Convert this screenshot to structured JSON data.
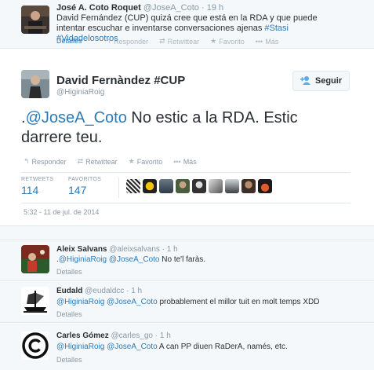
{
  "top_tweet": {
    "name": "José A. Coto Roquet",
    "handle": "@JoseA_Coto",
    "time": "19 h",
    "text_plain": "David Fernández (CUP) quizá cree que está en la RDA y que puede intentar escuchar e inventarse conversaciones ajenas",
    "hashtags": "#Stasi #Vidadelosotros",
    "details": "Detalles",
    "actions": {
      "reply": "Responder",
      "retweet": "Retwittear",
      "favorite": "Favorito",
      "more": "Más"
    }
  },
  "main_tweet": {
    "name": "David Fernàndez #CUP",
    "handle": "@HiginiaRoig",
    "follow_label": "Seguir",
    "text_prefix": ".",
    "mention": "@JoseA_Coto",
    "text_body": " No estic a la RDA.  Estic darrere teu.",
    "actions": {
      "reply": "Responder",
      "retweet": "Retwittear",
      "favorite": "Favorito",
      "more": "Más"
    },
    "retweets_label": "RETWEETS",
    "retweets": "114",
    "favorites_label": "FAVORITOS",
    "favorites": "147",
    "date": "5:32 - 11 de jul. de 2014"
  },
  "replies": [
    {
      "name": "Aleix Salvans",
      "handle": "@aleixsalvans",
      "time": "1 h",
      "prefix": ".",
      "mentions": "@HiginiaRoig @JoseA_Coto",
      "text": " No te'l faràs.",
      "details": "Detalles"
    },
    {
      "name": "Eudald",
      "handle": "@eudaldcc",
      "time": "1 h",
      "prefix": "",
      "mentions": "@HiginiaRoig @JoseA_Coto",
      "text": " probablement el millor tuit en molt temps XDD",
      "details": "Detalles"
    },
    {
      "name": "Carles Gómez",
      "handle": "@carles_go",
      "time": "1 h",
      "prefix": "",
      "mentions": "@HiginiaRoig @JoseA_Coto",
      "text": " A can PP diuen RaDerA, namés, etc.",
      "details": "Detalles"
    }
  ],
  "colors": {
    "link": "#2b7bb9",
    "muted": "#8899a6",
    "follow_icon": "#55acee"
  },
  "icons": [
    "reply-icon",
    "retweet-icon",
    "favorite-icon",
    "more-icon",
    "follow-user-icon",
    "copyright-icon"
  ]
}
